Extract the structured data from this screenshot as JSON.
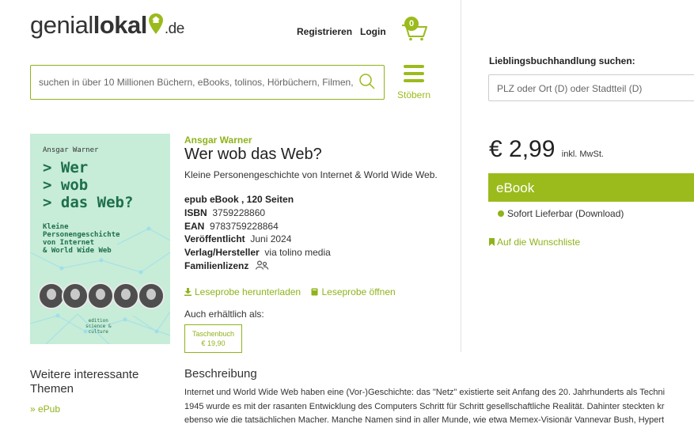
{
  "header": {
    "logo": {
      "part1": "genial",
      "part2": "lokal",
      "suffix": ".de",
      "accent": "#9bbb1c"
    },
    "register_label": "Registrieren",
    "login_label": "Login",
    "cart_count": "0",
    "search": {
      "placeholder": "suchen in über 10 Millionen Büchern, eBooks, tolinos, Hörbüchern, Filmen,"
    },
    "menu_label": "Stöbern",
    "store_search": {
      "label": "Lieblingsbuchhandlung suchen:",
      "placeholder": "PLZ oder Ort (D) oder Stadtteil (D)"
    }
  },
  "cover": {
    "author": "Ansgar Warner",
    "title": "> Wer\n> wob\n> das Web?",
    "subtitle": "Kleine\nPersonengeschichte\nvon Internet\n& World Wide Web",
    "edition": "edition\nscience &\nculture"
  },
  "product": {
    "author": "Ansgar Warner",
    "title": "Wer wob das Web?",
    "subtitle": "Kleine Personengeschichte von Internet & World Wide Web.",
    "format": "epub eBook , 120 Seiten",
    "isbn_label": "ISBN",
    "isbn": "3759228860",
    "ean_label": "EAN",
    "ean": "9783759228864",
    "published_label": "Veröffentlicht",
    "published": "Juni 2024",
    "publisher_label": "Verlag/Hersteller",
    "publisher": "via tolino media",
    "family_license": "Familienlizenz",
    "download_sample": "Leseprobe herunterladen",
    "open_sample": "Leseprobe öffnen",
    "also_available": "Auch erhältlich als:",
    "alt_format": {
      "label": "Taschenbuch",
      "price": "€ 19,90"
    }
  },
  "purchase": {
    "price": "€ 2,99",
    "tax_note": "inkl. MwSt.",
    "format_button": "eBook",
    "availability": "Sofort Lieferbar (Download)",
    "wishlist": "Auf die Wunschliste"
  },
  "themes": {
    "heading": "Weitere interessante Themen",
    "items": [
      "» ePub"
    ]
  },
  "description": {
    "heading": "Beschreibung",
    "lines": [
      "Internet und World Wide Web haben eine (Vor-)Geschichte: das \"Netz\" existierte seit Anfang des 20. Jahrhunderts als Techni",
      "1945 wurde es mit der rasanten Entwicklung des Computers Schritt für Schritt gesellschaftliche Realität. Dahinter steckten kr",
      "ebenso wie die tatsächlichen Macher. Manche Namen sind in aller Munde, wie etwa Memex-Visionär Vannevar Bush, Hypert"
    ]
  }
}
